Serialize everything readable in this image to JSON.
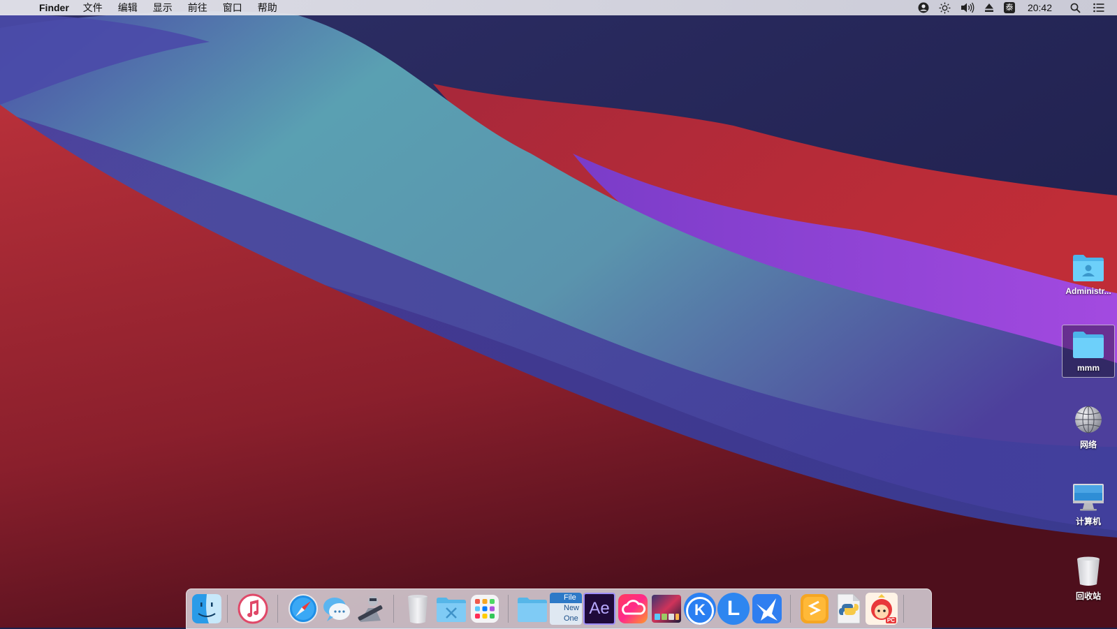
{
  "menubar": {
    "app_name": "Finder",
    "menus": [
      "文件",
      "编辑",
      "显示",
      "前往",
      "窗口",
      "帮助"
    ],
    "status_icons": [
      "user-circle-icon",
      "brightness-icon",
      "volume-icon",
      "eject-icon",
      "input-method-icon"
    ],
    "ime_label": "泰",
    "clock": "20:42",
    "right_icons": [
      "spotlight-search-icon",
      "notification-list-icon"
    ]
  },
  "desktop": {
    "icons": [
      {
        "label": "Administr...",
        "icon": "user-folder-icon"
      },
      {
        "label": "mmm",
        "icon": "folder-icon",
        "selected": true
      },
      {
        "label": "网络",
        "icon": "network-globe-icon"
      },
      {
        "label": "计算机",
        "icon": "computer-monitor-icon"
      },
      {
        "label": "回收站",
        "icon": "trash-icon"
      }
    ]
  },
  "dock": {
    "apps": [
      {
        "name": "finder-icon"
      },
      {
        "name": "itunes-icon"
      },
      {
        "name": "safari-icon"
      },
      {
        "name": "messages-icon"
      },
      {
        "name": "automator-icon"
      },
      {
        "name": "trash-can-icon"
      },
      {
        "name": "utilities-folder-icon"
      },
      {
        "name": "launchpad-icon"
      },
      {
        "name": "folder-icon"
      },
      {
        "name": "file-new-icon",
        "text": [
          "File",
          "New",
          "One"
        ]
      },
      {
        "name": "after-effects-icon",
        "text": "Ae"
      },
      {
        "name": "creative-cloud-icon"
      },
      {
        "name": "screen-tiles-icon"
      },
      {
        "name": "k-app-icon",
        "text": "K"
      },
      {
        "name": "l-app-icon",
        "text": "L"
      },
      {
        "name": "feishu-icon"
      },
      {
        "name": "sublime-text-icon"
      },
      {
        "name": "python-file-icon"
      },
      {
        "name": "mascot-pc-icon",
        "text": "PC"
      }
    ]
  },
  "colors": {
    "folder_blue": "#5ac8fa",
    "dock_bg": "#e6e6ec",
    "wall_red": "#b22a35",
    "wall_teal": "#5aa3b4",
    "wall_purple": "#9a45d6",
    "wall_navy": "#23244f"
  }
}
